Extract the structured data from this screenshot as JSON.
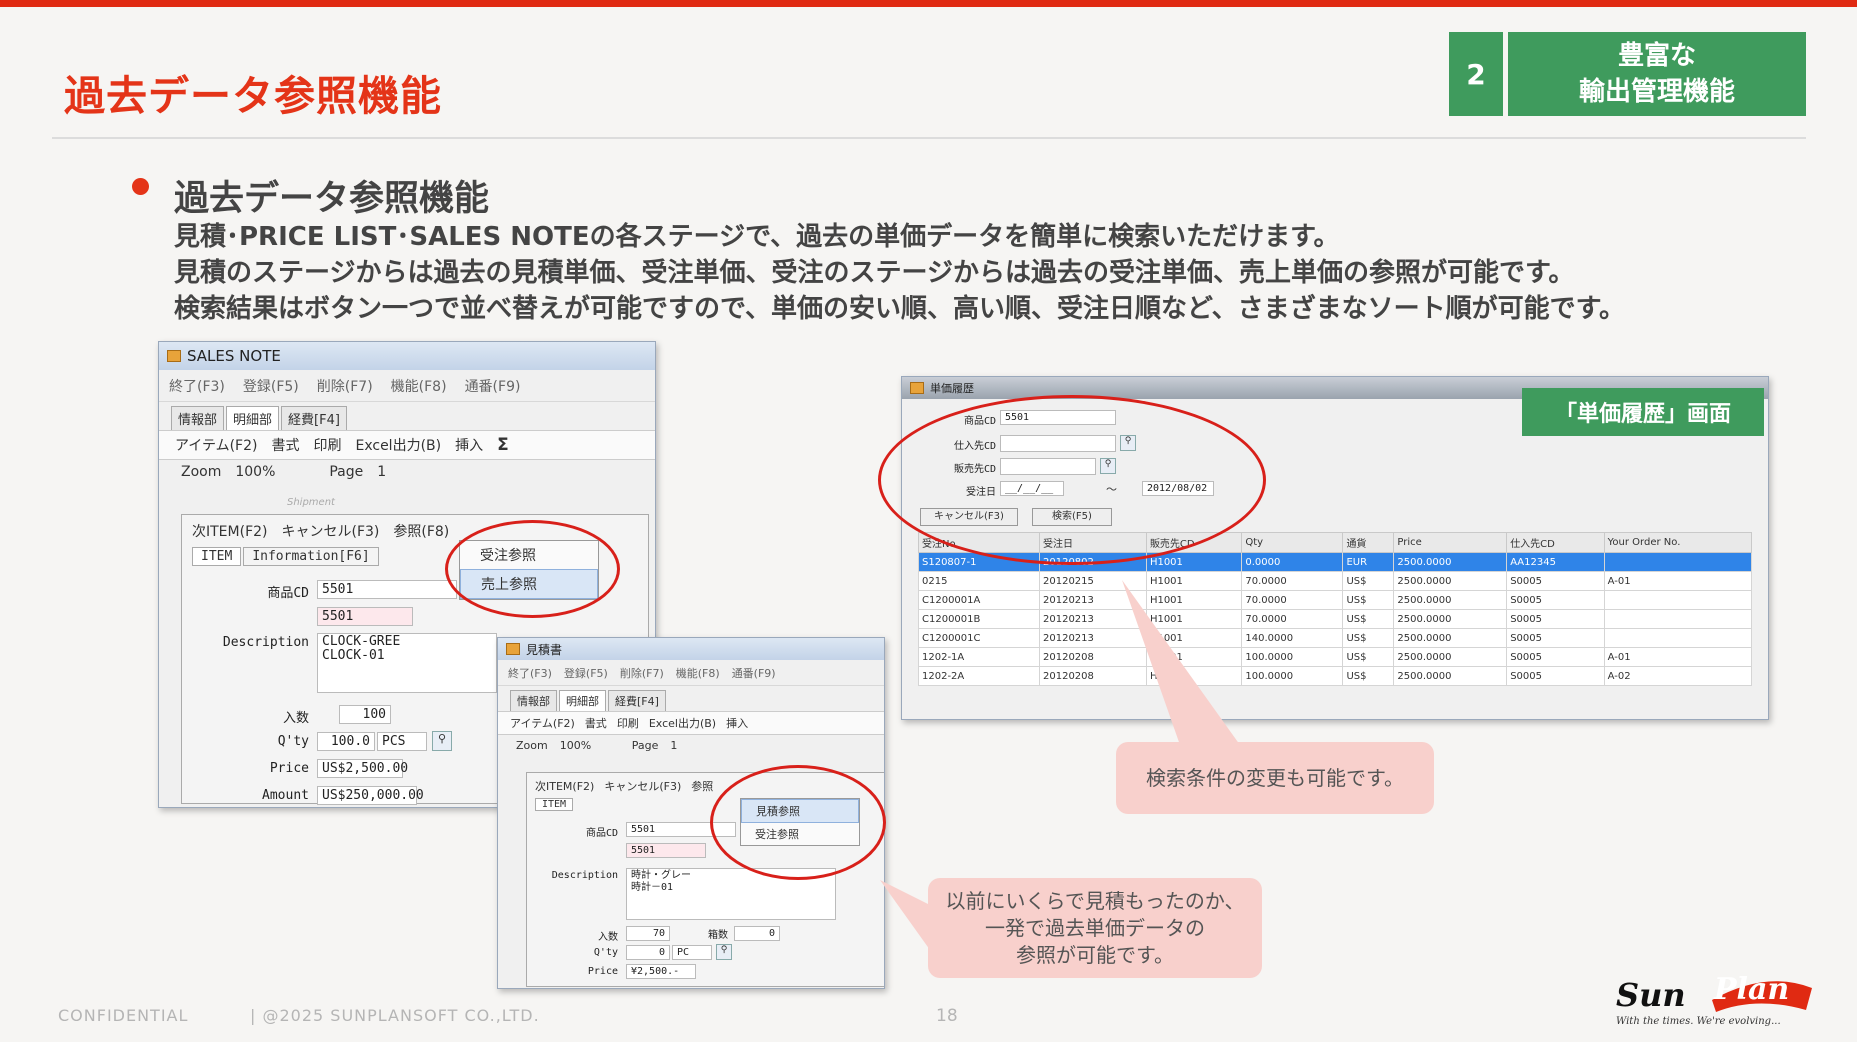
{
  "slide": {
    "title": "過去データ参照機能",
    "badge_number": "2",
    "badge_line1": "豊富な",
    "badge_line2": "輸出管理機能",
    "bullet_title": "過去データ参照機能",
    "lines": [
      "見積･PRICE LIST･SALES NOTEの各ステージで、過去の単価データを簡単に検索いただけます。",
      "見積のステージからは過去の見積単価、受注単価、受注のステージからは過去の受注単価、売上単価の参照が可能です。",
      "検索結果はボタン一つで並べ替えが可能ですので、単価の安い順、高い順、受注日順など、さまざまなソート順が可能です。"
    ],
    "colors": {
      "accent": "#e43418",
      "badge": "#3f9b5d",
      "callout": "#f8d0cc"
    }
  },
  "sales_note": {
    "title": "SALES NOTE",
    "toolbar": [
      "終了(F3)",
      "登録(F5)",
      "削除(F7)",
      "機能(F8)",
      "通番(F9)"
    ],
    "tabs": [
      "情報部",
      "明細部",
      "経費[F4]"
    ],
    "tb2": [
      "アイテム(F2)",
      "書式",
      "印刷",
      "Excel出力(B)",
      "挿入",
      "Σ"
    ],
    "zoom_label": "Zoom",
    "zoom_value": "100%",
    "page_label": "Page",
    "page_value": "1",
    "shipment": "Shipment",
    "item_bar": [
      "次ITEM(F2)",
      "キャンセル(F3)",
      "参照(F8)"
    ],
    "subtabs": [
      "ITEM",
      "Information[F6]"
    ],
    "menu": [
      "受注参照",
      "売上参照"
    ],
    "fields": {
      "code_label": "商品CD",
      "code_value": "5501",
      "code_value2": "5501",
      "desc_label": "Description",
      "desc_value": "CLOCK-GREE\nCLOCK-01",
      "irisu_label": "入数",
      "irisu_value": "100",
      "qty_label": "Q'ty",
      "qty_value": "100.0",
      "qty_unit": "PCS",
      "price_label": "Price",
      "price_value": "US$2,500.00",
      "amount_label": "Amount",
      "amount_value": "US$250,000.00"
    }
  },
  "mitsumori": {
    "title": "見積書",
    "toolbar": [
      "終了(F3)",
      "登録(F5)",
      "削除(F7)",
      "機能(F8)",
      "通番(F9)"
    ],
    "tabs": [
      "情報部",
      "明細部",
      "経費[F4]"
    ],
    "tb2": [
      "アイテム(F2)",
      "書式",
      "印刷",
      "Excel出力(B)",
      "挿入"
    ],
    "zoom_label": "Zoom",
    "zoom_value": "100%",
    "page_label": "Page",
    "page_value": "1",
    "item_bar": [
      "次ITEM(F2)",
      "キャンセル(F3)",
      "参照"
    ],
    "subtab": "ITEM",
    "menu": [
      "見積参照",
      "受注参照"
    ],
    "fields": {
      "code_label": "商品CD",
      "code_value": "5501",
      "code_value2": "5501",
      "desc_label": "Description",
      "desc_value": "時計・グレー\n時計－01",
      "irisu_label": "入数",
      "irisu_value": "70",
      "hako_label": "箱数",
      "hako_value": "0",
      "qty_label": "Q'ty",
      "qty_value": "0",
      "qty_unit": "PC",
      "price_label": "Price",
      "price_value": "¥2,500.-"
    }
  },
  "history": {
    "title": "単価履歴",
    "screen_label": "「単価履歴」画面",
    "form": {
      "code_label": "商品CD",
      "code_value": "5501",
      "supplier_label": "仕入先CD",
      "customer_label": "販売先CD",
      "date_label": "受注日",
      "date_from": "__/__/__",
      "tilde": "～",
      "date_to": "2012/08/02"
    },
    "buttons": [
      "キャンセル(F3)",
      "検索(F5)"
    ],
    "columns": [
      "受注No",
      "受注日",
      "販売先CD",
      "Qty",
      "通貨",
      "Price",
      "仕入先CD",
      "Your Order No."
    ],
    "rows": [
      [
        "S120807-1",
        "20120802",
        "H1001",
        "0.0000",
        "EUR",
        "2500.0000",
        "AA12345",
        ""
      ],
      [
        "0215",
        "20120215",
        "H1001",
        "70.0000",
        "US$",
        "2500.0000",
        "S0005",
        "A-01"
      ],
      [
        "C1200001A",
        "20120213",
        "H1001",
        "70.0000",
        "US$",
        "2500.0000",
        "S0005",
        ""
      ],
      [
        "C1200001B",
        "20120213",
        "H1001",
        "70.0000",
        "US$",
        "2500.0000",
        "S0005",
        ""
      ],
      [
        "C1200001C",
        "20120213",
        "H1001",
        "140.0000",
        "US$",
        "2500.0000",
        "S0005",
        ""
      ],
      [
        "1202-1A",
        "20120208",
        "H1001",
        "100.0000",
        "US$",
        "2500.0000",
        "S0005",
        "A-01"
      ],
      [
        "1202-2A",
        "20120208",
        "H1001",
        "100.0000",
        "US$",
        "2500.0000",
        "S0005",
        "A-02"
      ]
    ]
  },
  "callouts": {
    "search": "検索条件の変更も可能です。",
    "past_line1": "以前にいくらで見積もったのか、",
    "past_line2": "一発で過去単価データの",
    "past_line3": "参照が可能です。"
  },
  "footer": {
    "confidential": "CONFIDENTIAL",
    "copyright": "|  @2025 SUNPLANSOFT CO.,LTD.",
    "page": "18",
    "logo_sun": "Sun",
    "logo_plan": "Plan",
    "logo_tagline": "With the times. We're evolving..."
  }
}
